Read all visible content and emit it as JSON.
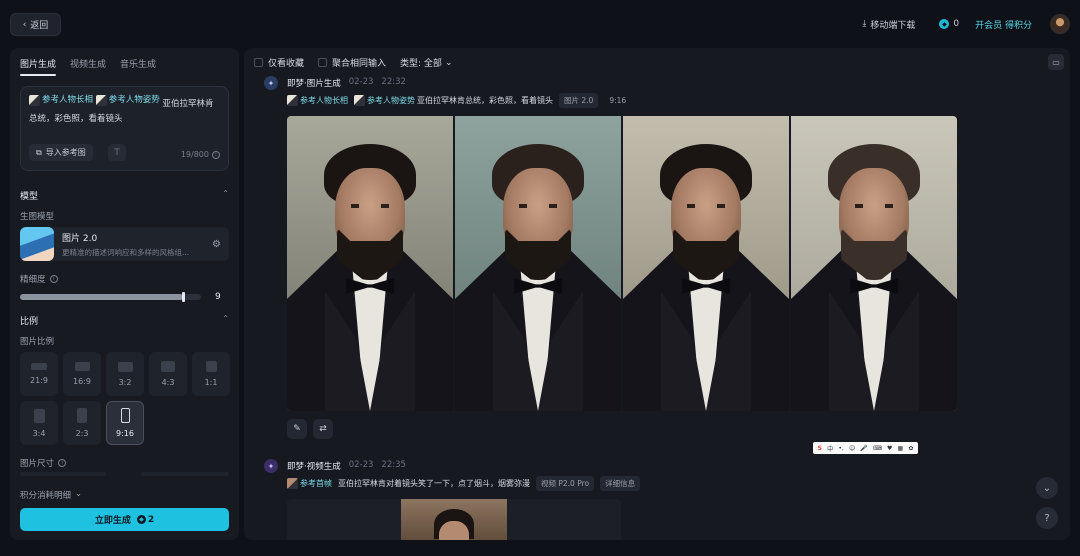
{
  "topbar": {
    "back_label": "返回",
    "download_label": "移动端下载",
    "credits": "0",
    "vip_label": "开会员 得积分"
  },
  "left": {
    "tabs": [
      "图片生成",
      "视频生成",
      "音乐生成"
    ],
    "prompt": {
      "ref1": "参考人物长相",
      "ref2": "参考人物姿势",
      "text": "亚伯拉罕林肯总统，彩色照，看着镜头",
      "import_label": "导入参考图",
      "t_icon": "T",
      "counter": "19/800"
    },
    "model_section": "模型",
    "gen_model_label": "生图模型",
    "model_name": "图片 2.0",
    "model_desc": "更精准的描述词响应和多样的风格组...",
    "precision_label": "精细度",
    "precision_value": "9",
    "precision_fraction": 0.9,
    "ratio_section": "比例",
    "ratio_label": "图片比例",
    "ratios": [
      "21:9",
      "16:9",
      "3:2",
      "4:3",
      "1:1",
      "3:4",
      "2:3",
      "9:16"
    ],
    "size_label": "图片尺寸",
    "cost_label": "积分消耗明细",
    "generate_label": "立即生成",
    "generate_cost": "2"
  },
  "main": {
    "filter_fav": "仅看收藏",
    "filter_merge": "聚合相同输入",
    "filter_type": "类型: 全部",
    "entry1": {
      "title": "即梦·图片生成",
      "date": "02-23",
      "time": "22:32",
      "ref1": "参考人物长相",
      "ref2": "参考人物姿势",
      "text": "亚伯拉罕林肯总统，彩色照，看着镜头",
      "tag_model": "图片 2.0",
      "tag_ratio": "9:16"
    },
    "entry2": {
      "title": "即梦·视频生成",
      "date": "02-23",
      "time": "22:35",
      "ref": "参考首帧",
      "text": "亚伯拉罕林肯对着镜头笑了一下，点了烟斗，烟雾弥漫",
      "tag_model": "视频 P2.0 Pro",
      "tag_detail": "详细信息"
    },
    "ime": [
      "S",
      "中",
      "•,",
      "☺",
      "🎤",
      "⌨",
      "♥",
      "▦",
      "✿"
    ]
  },
  "colors": {
    "accent": "#1ec2e0",
    "panel": "#171a21",
    "background": "#0e1117"
  }
}
